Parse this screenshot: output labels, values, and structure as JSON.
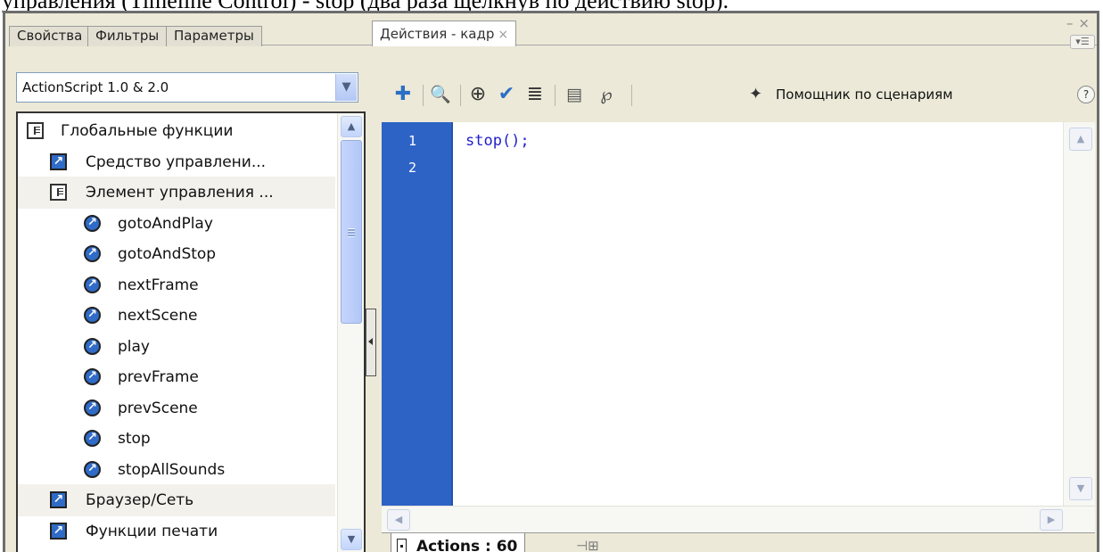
{
  "caption": "управления (Timeline Control) - stop (два раза щелкнув по действию stop).",
  "tabs": [
    {
      "label": "Свойства"
    },
    {
      "label": "Фильтры"
    },
    {
      "label": "Параметры"
    },
    {
      "label": "Действия - кадр",
      "active": true
    }
  ],
  "window": {
    "minimize": "–",
    "close": "×",
    "menu": "▾☰"
  },
  "script_selector": {
    "value": "ActionScript 1.0 & 2.0"
  },
  "tree": [
    {
      "label": "Глобальные функции",
      "icon": "book-icon",
      "level": 0,
      "shaded": false
    },
    {
      "label": "Средство управлени...",
      "icon": "action-square-icon",
      "level": 1,
      "shaded": false
    },
    {
      "label": "Элемент управления ...",
      "icon": "book-icon",
      "level": 1,
      "shaded": true
    },
    {
      "label": "gotoAndPlay",
      "icon": "action-circle-icon",
      "level": 2,
      "shaded": false
    },
    {
      "label": "gotoAndStop",
      "icon": "action-circle-icon",
      "level": 2,
      "shaded": false
    },
    {
      "label": "nextFrame",
      "icon": "action-circle-icon",
      "level": 2,
      "shaded": false
    },
    {
      "label": "nextScene",
      "icon": "action-circle-icon",
      "level": 2,
      "shaded": false
    },
    {
      "label": "play",
      "icon": "action-circle-icon",
      "level": 2,
      "shaded": false
    },
    {
      "label": "prevFrame",
      "icon": "action-circle-icon",
      "level": 2,
      "shaded": false
    },
    {
      "label": "prevScene",
      "icon": "action-circle-icon",
      "level": 2,
      "shaded": false
    },
    {
      "label": "stop",
      "icon": "action-circle-icon",
      "level": 2,
      "shaded": false
    },
    {
      "label": "stopAllSounds",
      "icon": "action-circle-icon",
      "level": 2,
      "shaded": false
    },
    {
      "label": "Браузер/Сеть",
      "icon": "action-square-icon",
      "level": 1,
      "shaded": true
    },
    {
      "label": "Функции печати",
      "icon": "action-square-icon",
      "level": 1,
      "shaded": false
    }
  ],
  "toolbar": {
    "icons": [
      "add-script-icon",
      "find-icon",
      "target-path-icon",
      "check-syntax-icon",
      "auto-format-icon",
      "code-hint-icon",
      "debug-options-icon"
    ],
    "assistant_label": "Помощник по сценариям",
    "help": "?"
  },
  "editor": {
    "line_numbers": [
      "1",
      "2"
    ],
    "code_lines": [
      "stop();",
      ""
    ]
  },
  "status": {
    "tab_label": "Actions : 60"
  },
  "colors": {
    "gutter": "#2e63c6",
    "keyword": "#1f1fcc",
    "panel_bg": "#ece9d8"
  }
}
